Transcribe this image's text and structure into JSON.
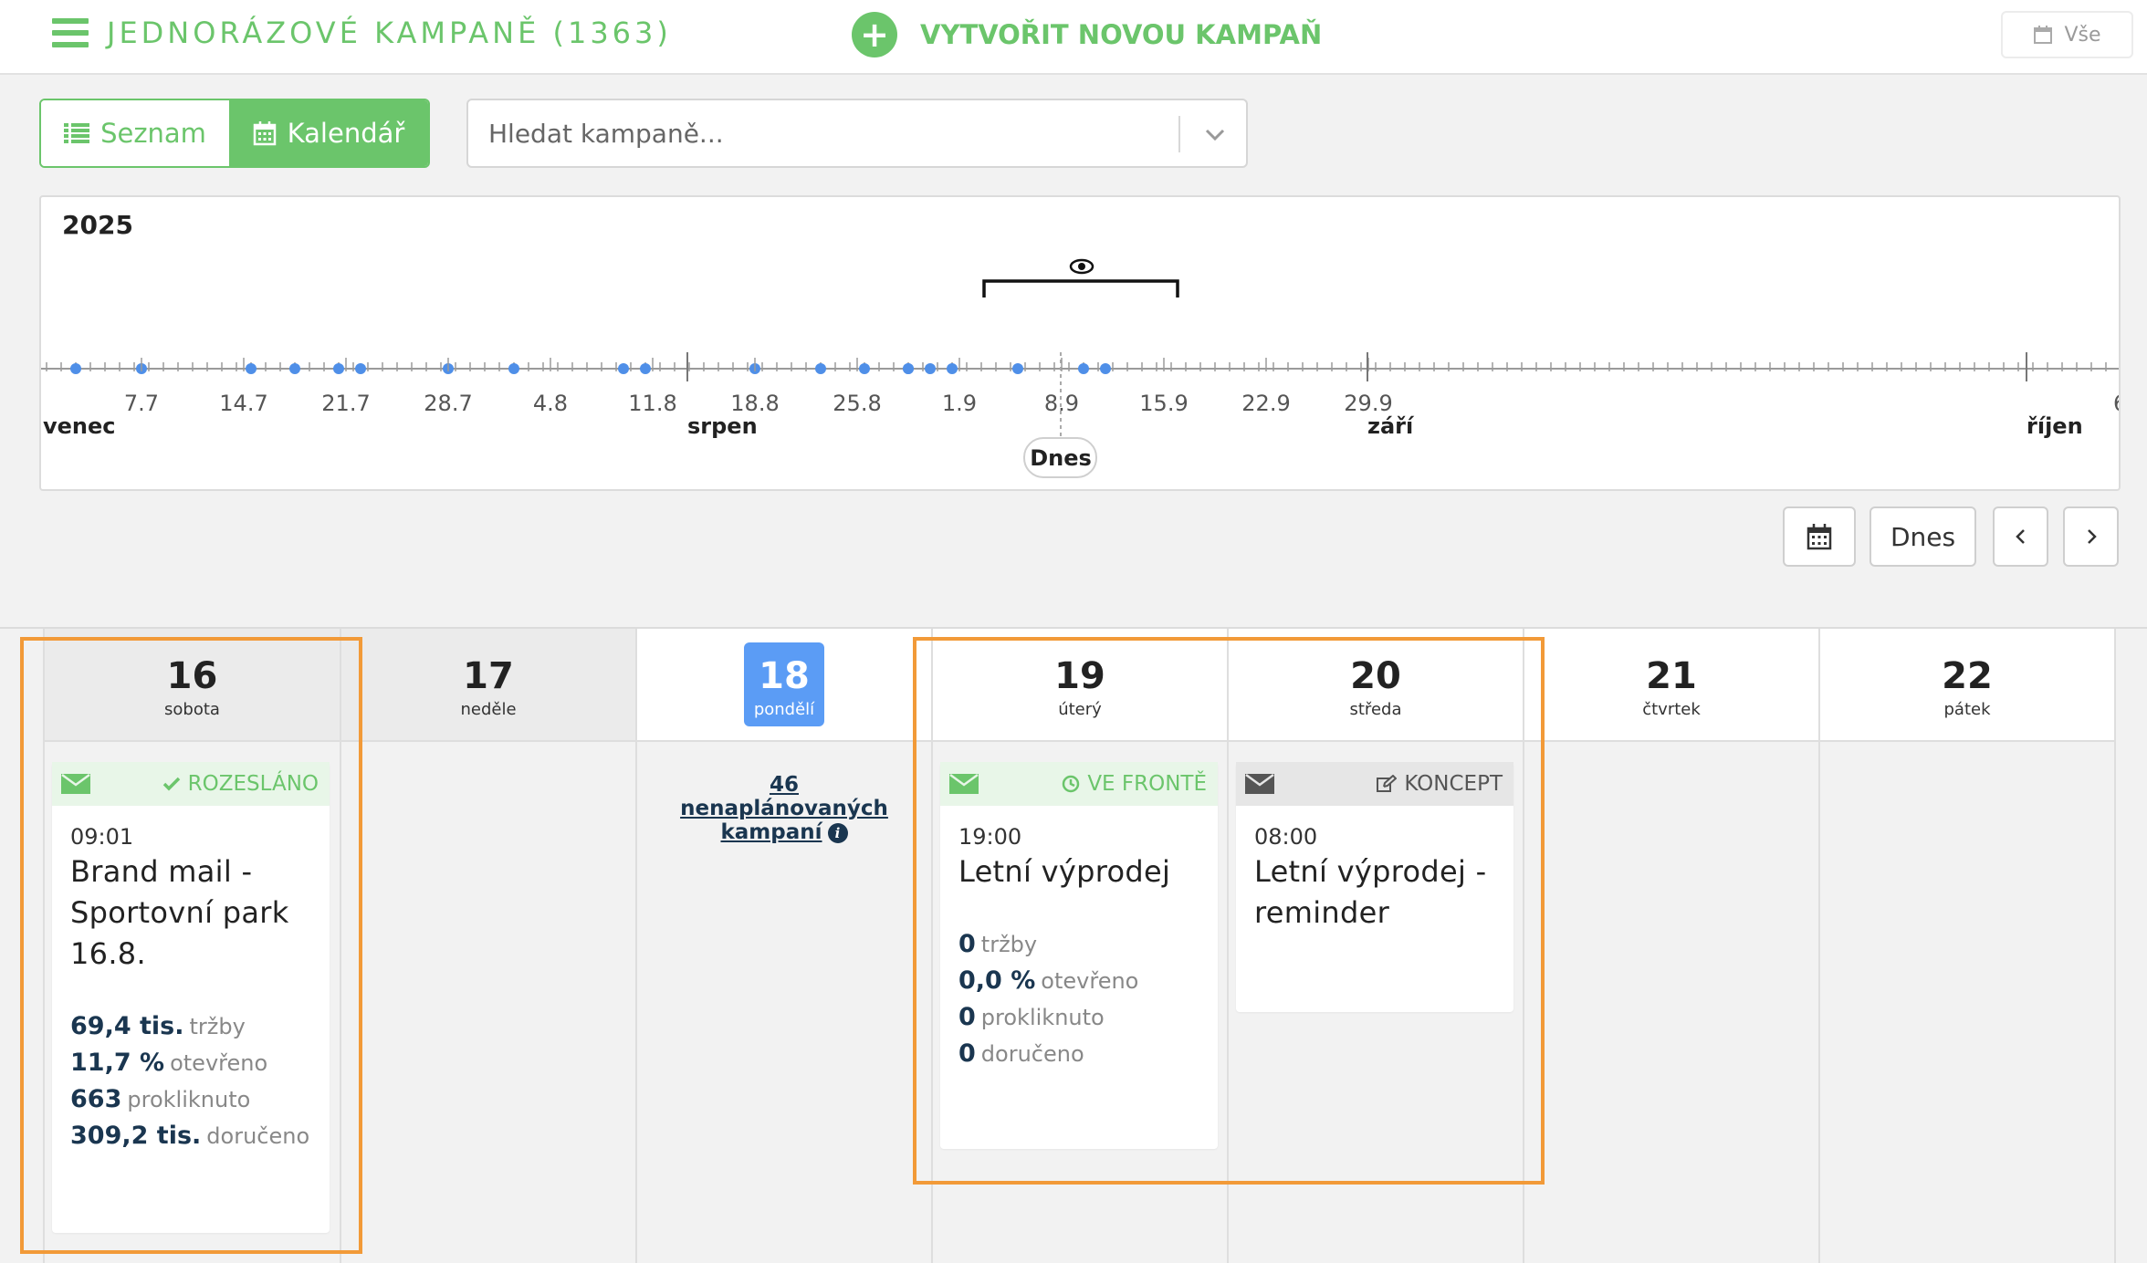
{
  "header": {
    "title": "JEDNORÁZOVÉ KAMPANĚ (1363)",
    "new_campaign_label": "VYTVOŘIT NOVOU KAMPAŇ",
    "range_label": "Vše"
  },
  "toolbar": {
    "list_label": "Seznam",
    "calendar_label": "Kalendář",
    "search_placeholder": "Hledat kampaně..."
  },
  "timeline": {
    "year": "2025",
    "today_label": "Dnes",
    "date_labels": [
      "7.7",
      "14.7",
      "21.7",
      "28.7",
      "4.8",
      "11.8",
      "18.8",
      "25.8",
      "1.9",
      "8.9",
      "15.9",
      "22.9",
      "29.9"
    ],
    "month_labels": [
      "venec",
      "srpen",
      "září",
      "říjen"
    ],
    "edge_label": "6"
  },
  "nav": {
    "today_label": "Dnes"
  },
  "calendar": {
    "days": [
      {
        "num": "16",
        "name": "sobota"
      },
      {
        "num": "17",
        "name": "neděle"
      },
      {
        "num": "18",
        "name": "pondělí"
      },
      {
        "num": "19",
        "name": "úterý"
      },
      {
        "num": "20",
        "name": "středa"
      },
      {
        "num": "21",
        "name": "čtvrtek"
      },
      {
        "num": "22",
        "name": "pátek"
      }
    ],
    "unscheduled": {
      "count": "46",
      "line1": "nenaplánovaných",
      "line2": "kampaní"
    },
    "campaigns": [
      {
        "status": "ROZESLÁNO",
        "time": "09:01",
        "title_lines": [
          "Brand mail -",
          "Sportovní park",
          "16.8."
        ],
        "stats": [
          {
            "value": "69,4 tis.",
            "label": "tržby"
          },
          {
            "value": "11,7 %",
            "label": "otevřeno"
          },
          {
            "value": "663",
            "label": "prokliknuto"
          },
          {
            "value": "309,2 tis.",
            "label": "doručeno"
          }
        ]
      },
      {
        "status": "VE FRONTĚ",
        "time": "19:00",
        "title_lines": [
          "Letní výprodej"
        ],
        "stats": [
          {
            "value": "0",
            "label": "tržby"
          },
          {
            "value": "0,0 %",
            "label": "otevřeno"
          },
          {
            "value": "0",
            "label": "prokliknuto"
          },
          {
            "value": "0",
            "label": "doručeno"
          }
        ]
      },
      {
        "status": "KONCEPT",
        "time": "08:00",
        "title_lines": [
          "Letní výprodej -",
          "reminder"
        ]
      }
    ]
  },
  "colors": {
    "brand_green": "#6bc56b",
    "today_blue": "#5b9cf5",
    "highlight_orange": "#f29a38",
    "stat_navy": "#1a3650"
  }
}
